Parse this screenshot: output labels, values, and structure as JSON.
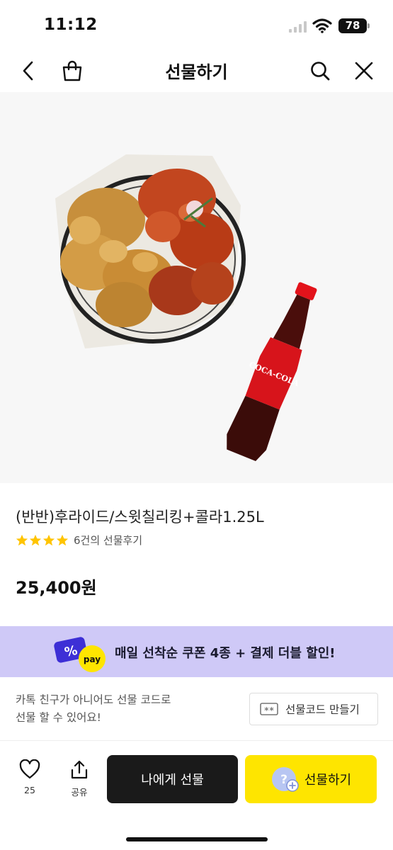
{
  "status_bar": {
    "time": "11:12",
    "battery": "78"
  },
  "header": {
    "title": "선물하기",
    "back_icon": "chevron-left-icon",
    "bag_icon": "shopping-bag-icon",
    "search_icon": "search-icon",
    "close_icon": "close-icon"
  },
  "product": {
    "name": "(반반)후라이드/스윗칠리킹+콜라1.25L",
    "rating": 4,
    "rating_max": 4,
    "review_text": "6건의 선물후기",
    "price": "25,400원",
    "image_label": "COCA-COLA"
  },
  "promo": {
    "text": "매일 선착순 쿠폰 4종 + 결제 더블 할인!",
    "badge_percent": "%",
    "badge_pay": "pay",
    "background": "#cfc9f7"
  },
  "giftcode": {
    "desc_line1": "카톡 친구가 아니어도 선물 코드로",
    "desc_line2": "선물 할 수 있어요!",
    "button_label": "선물코드 만들기",
    "button_icon_text": "**"
  },
  "bottom": {
    "like_count": "25",
    "share_label": "공유",
    "gift_me_label": "나에게 선물",
    "gift_label": "선물하기",
    "accent": "#fee500"
  }
}
